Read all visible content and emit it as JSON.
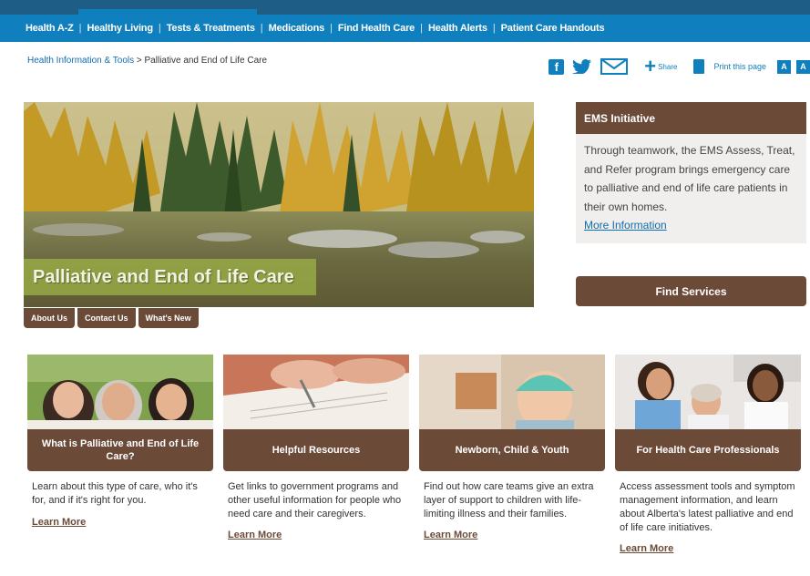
{
  "nav": {
    "items": [
      "Health A-Z",
      "Healthy Living",
      "Tests & Treatments",
      "Medications",
      "Find Health Care",
      "Health Alerts",
      "Patient Care Handouts"
    ]
  },
  "breadcrumb": {
    "parent": "Health Information & Tools",
    "separator": ">",
    "current": "Palliative and End of Life Care"
  },
  "tools": {
    "facebook_glyph": "f",
    "share_label": "Share",
    "print_label": "Print this page",
    "font_small": "A",
    "font_large": "A"
  },
  "hero": {
    "title": "Palliative and End of Life Care"
  },
  "subtabs": [
    "About Us",
    "Contact Us",
    "What's New"
  ],
  "ems": {
    "heading": "EMS Initiative",
    "body": "Through teamwork, the EMS Assess, Treat, and Refer program brings emergency care to palliative and end of life care patients in their own homes.",
    "link": "More Information"
  },
  "find_services": "Find Services",
  "cards": [
    {
      "title": "What is Palliative and End of Life Care?",
      "description": "Learn about this type of care, who it's for, and if it's right for you.",
      "link": "Learn More"
    },
    {
      "title": "Helpful Resources",
      "description": "Get links to government programs and other useful information for people who need care and their caregivers.",
      "link": "Learn More"
    },
    {
      "title": "Newborn, Child & Youth",
      "description": "Find out how care teams give an extra layer of support to children with life-limiting illness and their families.",
      "link": "Learn More"
    },
    {
      "title": "For Health Care Professionals",
      "description": "Access assessment tools and symptom management information, and learn about Alberta's latest palliative and end of life care initiatives.",
      "link": "Learn More"
    }
  ],
  "colors": {
    "nav_blue": "#0f7fbe",
    "brown": "#6b4a38",
    "link_blue": "#0f6db0"
  }
}
